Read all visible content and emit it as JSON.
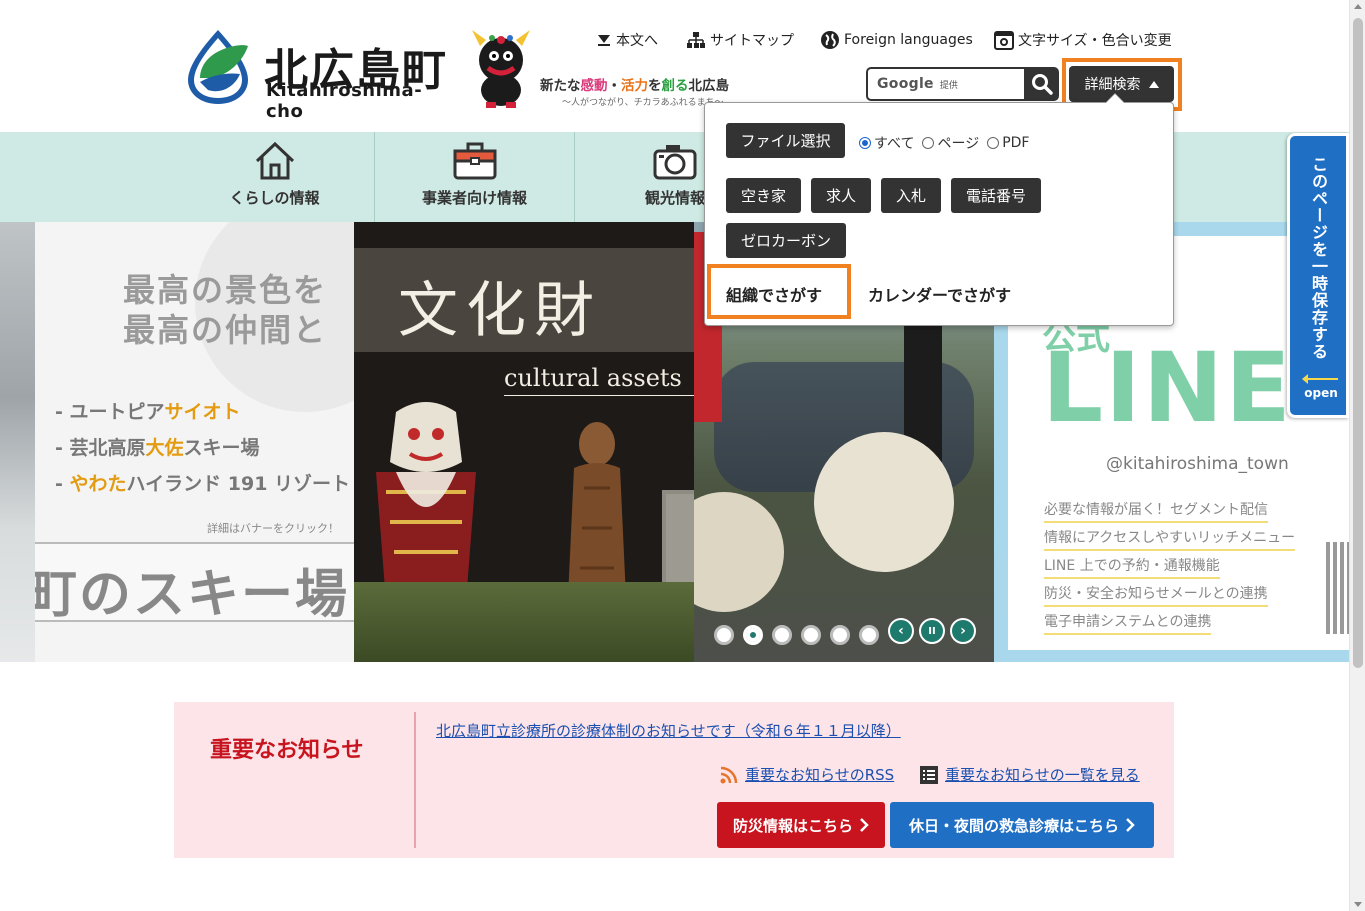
{
  "header": {
    "logo_title": "北広島町",
    "logo_sub": "Kitahiroshima-cho",
    "slogan_main_parts": [
      "新たな",
      "感動",
      "・",
      "活力",
      "を",
      "創る",
      "北広島"
    ],
    "slogan_sub": "～人がつながり、チカラあふれるまち～",
    "top_links": {
      "skip": "本文へ",
      "sitemap": "サイトマップ",
      "foreign": "Foreign languages",
      "font_color": "文字サイズ・色合い変更"
    },
    "search": {
      "google_label": "Google",
      "provided_label": "提供",
      "advanced_label": "詳細検索"
    }
  },
  "nav": {
    "items": [
      {
        "label": "くらしの情報",
        "icon": "house-icon"
      },
      {
        "label": "事業者向け情報",
        "icon": "briefcase-icon"
      },
      {
        "label": "観光情報",
        "icon": "camera-icon"
      }
    ]
  },
  "dropdown": {
    "file_select": "ファイル選択",
    "radio_options": [
      "すべて",
      "ページ",
      "PDF"
    ],
    "radio_selected": "すべて",
    "quick_buttons": [
      "空き家",
      "求人",
      "入札",
      "電話番号",
      "ゼロカーボン"
    ],
    "link_org": "組織でさがす",
    "link_calendar": "カレンダーでさがす"
  },
  "carousel": {
    "ski": {
      "heading_line1": "最高の景色を",
      "heading_line2": "最高の仲間と",
      "resorts": [
        {
          "pre": "- ユートピア",
          "hl": "サイオト",
          "post": ""
        },
        {
          "pre": "- 芸北高原",
          "hl": "大佐",
          "post": "スキー場"
        },
        {
          "pre": "- ",
          "hl": "やわた",
          "post": "ハイランド 191 リゾート"
        }
      ],
      "note": "詳細はバナーをクリック！",
      "big_text": "町のスキー場"
    },
    "culture": {
      "title": "文化財",
      "subtitle": "cultural assets"
    },
    "line": {
      "heading": "公式",
      "big": "LINE",
      "handle": "@kitahiroshima_town",
      "features": [
        "必要な情報が届く！セグメント配信",
        "情報にアクセスしやすいリッチメニュー",
        "LINE 上での予約・通報機能",
        "防災・安全お知らせメールとの連携",
        "電子申請システムとの連携"
      ]
    },
    "slide_count": 6,
    "active_slide": 2,
    "controls": {
      "prev": "‹",
      "pause": "II",
      "next": "›"
    }
  },
  "side_tab": {
    "label": "このページを一時保存する",
    "open": "open"
  },
  "notice": {
    "title": "重要なお知らせ",
    "item": "北広島町立診療所の診療体制のお知らせです（令和６年１１月以降）",
    "rss": "重要なお知らせのRSS",
    "list": "重要なお知らせの一覧を見る",
    "disaster_btn": "防災情報はこちら",
    "emergency_btn": "休日・夜間の救急診療はこちら"
  },
  "colors": {
    "nav_band": "#cfeae4",
    "highlight_outline": "#f08020",
    "notice_bg": "#fce4e8",
    "notice_title": "#c8141e",
    "disaster_btn": "#c8141e",
    "emergency_btn": "#1f6fc5",
    "carousel_active": "#227a6e"
  }
}
